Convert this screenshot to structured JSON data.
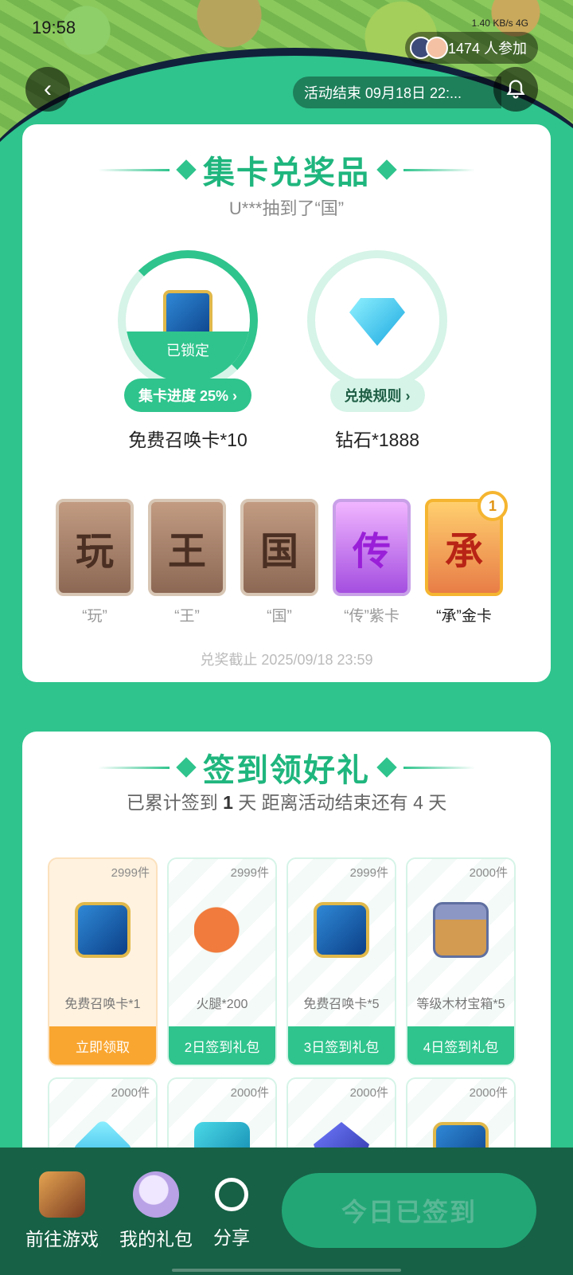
{
  "status_bar": {
    "time": "19:58",
    "indicators": "1.40 KB/s 4G"
  },
  "header": {
    "participants": "1474 人参加",
    "end_time": "活动结束 09月18日 22:..."
  },
  "collect": {
    "title": "集卡兑奖品",
    "ticker": "U***抽到了“国”",
    "prizes": [
      {
        "name": "免费召唤卡*10",
        "button": "集卡进度 25% ›",
        "lock_label": "已锁定",
        "progress": 0.25
      },
      {
        "name": "钻石*1888",
        "button": "兑换规则 ›"
      }
    ],
    "cards": [
      {
        "glyph": "玩",
        "label": "“玩”",
        "style": "normal"
      },
      {
        "glyph": "王",
        "label": "“王”",
        "style": "normal"
      },
      {
        "glyph": "国",
        "label": "“国”",
        "style": "normal"
      },
      {
        "glyph": "传",
        "label": "“传”紫卡",
        "style": "purple"
      },
      {
        "glyph": "承",
        "label": "“承”金卡",
        "style": "gold",
        "badge": "1"
      }
    ],
    "deadline": "兑奖截止 2025/09/18 23:59"
  },
  "signin": {
    "title": "签到领好礼",
    "summary_prefix": "已累计签到 ",
    "days": "1",
    "summary_suffix": " 天  距离活动结束还有 4 天",
    "items": [
      {
        "count": "2999件",
        "name": "免费召唤卡*1",
        "button": "立即领取",
        "icon": "summon-card",
        "active": true
      },
      {
        "count": "2999件",
        "name": "火腿*200",
        "button": "2日签到礼包",
        "icon": "ham"
      },
      {
        "count": "2999件",
        "name": "免费召唤卡*5",
        "button": "3日签到礼包",
        "icon": "summon-card"
      },
      {
        "count": "2000件",
        "name": "等级木材宝箱*5",
        "button": "4日签到礼包",
        "icon": "chest"
      },
      {
        "count": "2000件",
        "icon": "diamond"
      },
      {
        "count": "2000件",
        "icon": "cube"
      },
      {
        "count": "2000件",
        "icon": "crystal"
      },
      {
        "count": "2000件",
        "icon": "summon-card"
      }
    ]
  },
  "bottom_bar": {
    "game": "前往游戏",
    "gifts": "我的礼包",
    "share": "分享",
    "signin_button": "今日已签到"
  },
  "colors": {
    "accent": "#2fc48d",
    "dark": "#176146",
    "orange": "#f9a630"
  }
}
